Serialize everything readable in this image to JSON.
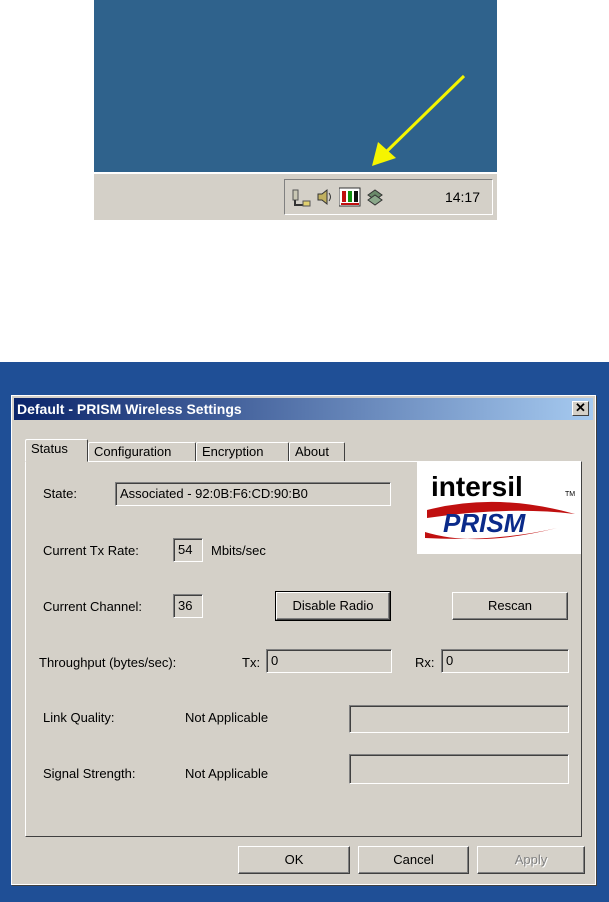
{
  "taskbar": {
    "clock": "14:17",
    "tray_icons": [
      "network-icon",
      "volume-icon",
      "prism-wireless-icon",
      "connection-icon"
    ],
    "arrow_color": "#f5f500"
  },
  "dialog": {
    "title": "Default - PRISM Wireless Settings",
    "close_glyph": "✕",
    "tabs": [
      {
        "label": "Status",
        "active": true
      },
      {
        "label": "Configuration",
        "active": false
      },
      {
        "label": "Encryption",
        "active": false
      },
      {
        "label": "About",
        "active": false
      }
    ],
    "status": {
      "state_label": "State:",
      "state_value": "Associated - 92:0B:F6:CD:90:B0",
      "tx_rate_label": "Current Tx Rate:",
      "tx_rate_value": "54",
      "tx_rate_unit": "Mbits/sec",
      "channel_label": "Current Channel:",
      "channel_value": "36",
      "disable_radio": "Disable Radio",
      "rescan": "Rescan",
      "throughput_label": "Throughput (bytes/sec):",
      "tx_label": "Tx:",
      "tx_value": "0",
      "rx_label": "Rx:",
      "rx_value": "0",
      "link_quality_label": "Link Quality:",
      "link_quality_value": "Not Applicable",
      "signal_strength_label": "Signal Strength:",
      "signal_strength_value": "Not Applicable"
    },
    "logo": {
      "brand": "intersil",
      "brand_mark": "TM",
      "product": "PRISM"
    },
    "buttons": {
      "ok": "OK",
      "cancel": "Cancel",
      "apply": "Apply"
    }
  }
}
